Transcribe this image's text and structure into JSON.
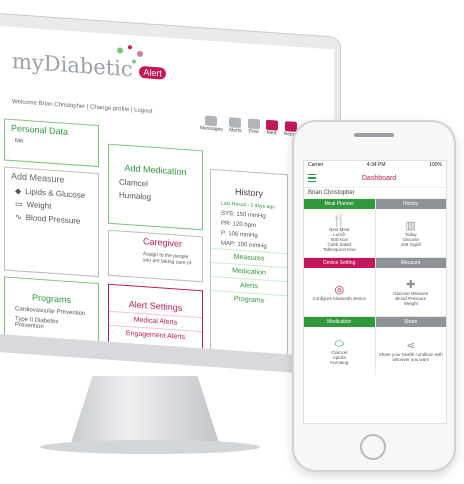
{
  "desktop": {
    "logo_text": "myDiabetic",
    "logo_badge": "Alert",
    "welcome": "Welcome Brian Christopher | Change profile | Logout",
    "toolbar": [
      {
        "label": "Messages",
        "icon": "envelope-icon"
      },
      {
        "label": "Alerts",
        "icon": "bell-icon"
      },
      {
        "label": "Print",
        "icon": "printer-icon"
      },
      {
        "label": "Med",
        "icon": "pill-icon"
      },
      {
        "label": "Report",
        "icon": "report-icon"
      }
    ],
    "personal_data": {
      "title": "Personal Data",
      "sub": "Me"
    },
    "measure": {
      "title": "Add Measure",
      "items": [
        "Lipids & Glucose",
        "Weight",
        "Blood Pressure"
      ]
    },
    "medication": {
      "title": "Add Medication",
      "items": [
        "Clamcel",
        "Humalog"
      ]
    },
    "caregiver": {
      "title": "Caregiver",
      "text": "Assign to the people you are taking care of"
    },
    "history": {
      "title": "History",
      "date": "Last Result - 1 days ago",
      "values": [
        "SYS: 150 mmHg",
        "PR: 120 bpm",
        "P: 106 mmHg",
        "MAP: 100 mmHg"
      ],
      "links": [
        "Measures",
        "Medication",
        "Alerts"
      ]
    },
    "programs": {
      "title": "Programs",
      "items": [
        "Cardiovascular Prevention",
        "Type II Diabetes Prevention"
      ]
    },
    "alert_settings": {
      "title": "Alert Settings",
      "items": [
        "Medical Alerts",
        "Engagement Alerts"
      ]
    },
    "footer_link": "Programs"
  },
  "phone": {
    "carrier": "Carrier",
    "time": "4:34 PM",
    "battery": "100%",
    "title": "Dashboard",
    "user": "Brian Christopher",
    "tiles": [
      {
        "header": "Meal Planner",
        "lines": [
          "Next Meal",
          "Lunch",
          "500 kcal",
          "Cobb Salad",
          "Tablespoon Kiwi"
        ],
        "tone": "g",
        "glyph": "fork-knife-icon"
      },
      {
        "header": "History",
        "lines": [
          "Today",
          "Glucose",
          "109 mg/dl"
        ],
        "tone": "gy",
        "glyph": "chart-icon"
      },
      {
        "header": "Device Setting",
        "lines": [
          "Configure bluetooth device"
        ],
        "tone": "m",
        "glyph": "target-icon"
      },
      {
        "header": "Measure",
        "lines": [
          "Glucose Measure",
          "Blood Pressure",
          "Weight"
        ],
        "tone": "gy",
        "glyph": "plus-leaf-icon"
      },
      {
        "header": "Medication",
        "lines": [
          "Clamcel",
          "Apidra",
          "Humalog"
        ],
        "tone": "g",
        "glyph": "pill-icon"
      },
      {
        "header": "Share",
        "lines": [
          "Share your health condition with whoever you want"
        ],
        "tone": "gy",
        "glyph": "share-icon"
      }
    ]
  }
}
